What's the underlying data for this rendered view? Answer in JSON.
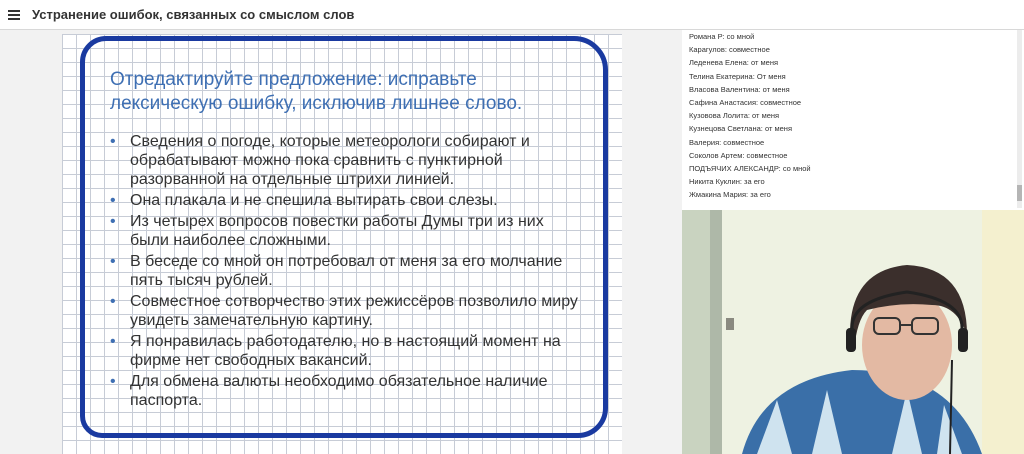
{
  "header": {
    "title": "Устранение ошибок, связанных со смыслом слов"
  },
  "slide": {
    "heading": "Отредактируйте предложение: исправьте лексическую ошибку, исключив лишнее слово.",
    "bullets": [
      "Сведения о погоде, которые метеорологи собирают и обрабатывают можно пока сравнить с пунктирной разорванной на отдельные штрихи линией.",
      "Она плакала и не спешила вытирать свои слезы.",
      "Из четырех вопросов повестки работы Думы три из них были наиболее сложными.",
      "В беседе со мной он потребовал от меня за его молчание пять тысяч рублей.",
      "Совместное сотворчество этих режиссёров позволило миру увидеть замечательную картину.",
      "Я понравилась работодателю, но в настоящий момент на фирме нет свободных вакансий.",
      "Для обмена валюты необходимо обязательное наличие паспорта."
    ]
  },
  "chat": {
    "messages": [
      "Романа Р: со мной",
      "Карагулов: совместное",
      "Леденева Елена: от меня",
      "Телина Екатерина: От меня",
      "Власова Валентина: от меня",
      "Сафина Анастасия: совместное",
      "Кузовова Лолита: от меня",
      "Кузнецова Светлана: от меня",
      "Валерия: совместное",
      "Соколов Артем: совместное",
      "ПОДЪЯЧИХ АЛЕКСАНДР: со мной",
      "Никита Куклин: за его",
      "Жмакина Мария: за его"
    ]
  },
  "colors": {
    "frame": "#1a3aa0",
    "heading": "#3e6fb3",
    "text": "#333333"
  },
  "icons": {
    "menu": "hamburger-menu-icon",
    "bullet": "bullet-dot"
  }
}
